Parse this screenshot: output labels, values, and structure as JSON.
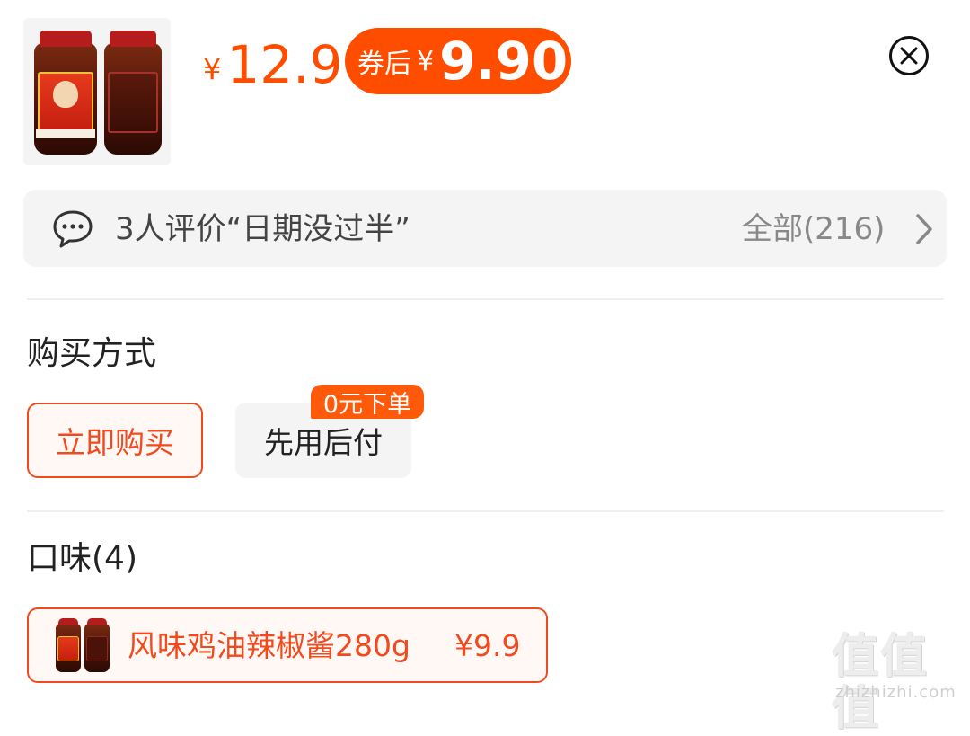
{
  "product": {
    "thumbnail_icon": "chili-oil-jar-image",
    "jar_label": "风味鸡油辣椒"
  },
  "price": {
    "currency": "¥",
    "original": "12.9",
    "coupon_label": "券后",
    "coupon_price": "9.90"
  },
  "close": {
    "icon": "close-circle-icon"
  },
  "reviews": {
    "summary": "3人评价“日期没过半”",
    "all_label": "全部(216)",
    "icon": "chat-bubble-icon",
    "chevron": "chevron-right-icon"
  },
  "purchase": {
    "title": "购买方式",
    "options": [
      {
        "label": "立即购买",
        "selected": true
      },
      {
        "label": "先用后付",
        "selected": false,
        "badge": "0元下单"
      }
    ]
  },
  "flavor": {
    "title": "口味(4)",
    "options": [
      {
        "name": "风味鸡油辣椒酱280g",
        "price": "¥9.9",
        "selected": true
      }
    ]
  },
  "watermark": {
    "main": "值值值",
    "sub": "zhizhizhi.com"
  },
  "colors": {
    "accent": "#ff4d00",
    "chip_border": "#f04a1e",
    "muted_bg": "#f4f4f4"
  }
}
